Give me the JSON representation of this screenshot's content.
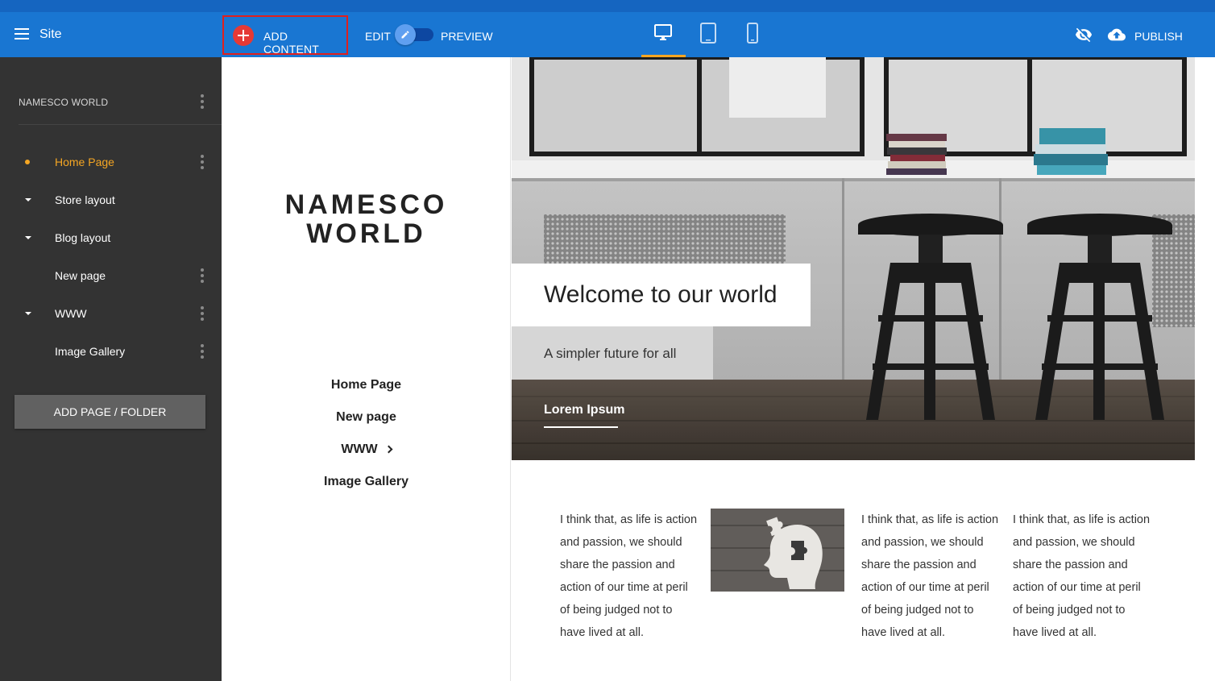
{
  "topbar": {
    "site_label": "Site",
    "add_content_label": "ADD CONTENT",
    "edit_label": "EDIT",
    "preview_label": "PREVIEW",
    "publish_label": "PUBLISH",
    "devices": [
      "desktop-icon",
      "tablet-icon",
      "mobile-icon"
    ],
    "active_device": "desktop"
  },
  "sidebar": {
    "site_name": "NAMESCO WORLD",
    "pages": [
      {
        "label": "Home Page",
        "active": true
      },
      {
        "label": "Store layout",
        "folder": true
      },
      {
        "label": "Blog layout",
        "folder": true
      },
      {
        "label": "New page"
      },
      {
        "label": "WWW",
        "folder": true
      },
      {
        "label": "Image Gallery"
      }
    ],
    "add_page_label": "ADD PAGE / FOLDER"
  },
  "canvas": {
    "logo_line1": "NAMESCO",
    "logo_line2": "WORLD",
    "nav": [
      "Home Page",
      "New page",
      "WWW",
      "Image Gallery"
    ],
    "hero": {
      "title": "Welcome to our world",
      "tagline": "A simpler future for all",
      "link": "Lorem Ipsum"
    },
    "columns": [
      "I think that, as life is action and passion, we should share the passion and action of our time at peril of being judged not to have lived at all.",
      "I think that, as life is action and passion, we should share the passion and action of our time at peril of being judged not to have lived at all.",
      "I think that, as life is action and passion, we should share the passion and action of our time at peril of being judged not to have lived at all."
    ]
  },
  "colors": {
    "topbar": "#1976d2",
    "sidebar": "#333333",
    "accent": "#f5a623",
    "add_button": "#e53935"
  }
}
